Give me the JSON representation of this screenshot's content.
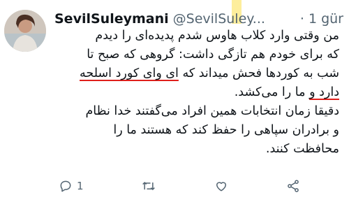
{
  "tweet": {
    "display_name": "SevilSuleymani",
    "handle": "@SevilSuley...",
    "time": "· 1 gür",
    "text_lines": [
      "من وقتی وارد کلاب هاوس شدم پدیده‌ای را دیدم",
      "که برای خودم هم تازگی داشت: گروهی که صبح تا",
      "شب به کوردها فحش میداند که ای وای کورد اسلحه",
      "دارد و ما را می‌کشد.",
      "دقیقا زمان انتخابات همین افراد می‌گفتند خدا نظام",
      "و برادران سپاهی را حفظ کند که هستند ما را",
      "محافظت کنند."
    ],
    "highlights": {
      "phrase_1": "ای وای کورد اسلحه",
      "phrase_2": "دارد و"
    },
    "highlight_color": "#e0201c",
    "actions": {
      "reply_count": "1",
      "retweet_icon": "retweet-icon",
      "like_icon": "heart-icon",
      "share_icon": "share-icon"
    }
  }
}
